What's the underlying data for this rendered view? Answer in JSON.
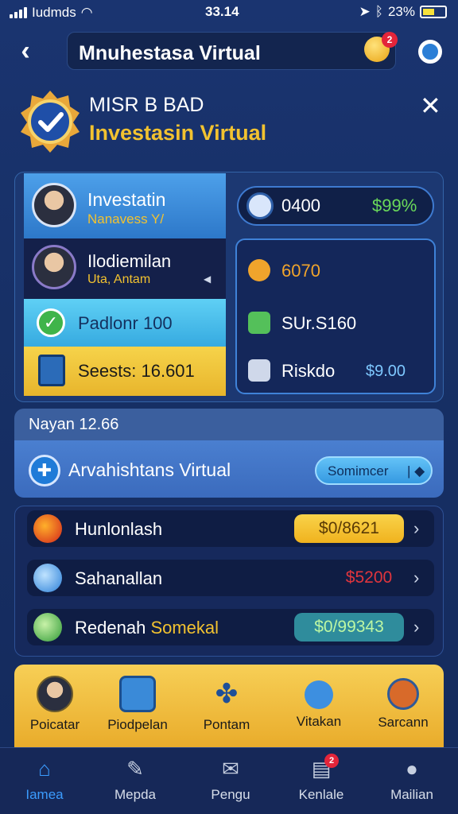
{
  "status_bar": {
    "carrier": "Iudmds",
    "time": "33.14",
    "battery": "23%"
  },
  "header": {
    "title": "Mnuhestasa Virtual",
    "notification_count": "2"
  },
  "hero": {
    "line1": "MISR B BAD",
    "line2": "Investasin Virtual"
  },
  "profile_card": {
    "row1": {
      "name": "Investatin",
      "sub": "Nanavess Y/"
    },
    "row2": {
      "name": "Ilodiemilan",
      "sub": "Uta, Antam"
    },
    "row3": {
      "label": "Padlonr 100"
    },
    "row4": {
      "label": "Seests: 16.601"
    }
  },
  "balance_pill": {
    "value": "0400",
    "percent": "$99%"
  },
  "stats_panel": {
    "item1": "6070",
    "item2": "SUr.S160",
    "item3": "Riskdo",
    "item3_value": "$9.00"
  },
  "strip": {
    "heading": "Nayan 12.66",
    "label": "Arvahishtans Virtual",
    "button": "Somimcer"
  },
  "list": [
    {
      "label": "Hunlonlash",
      "value": "$0/8621",
      "value_color": "#f0b21e"
    },
    {
      "label": "Sahanallan",
      "value": "$5200",
      "value_color": "#e0353d"
    },
    {
      "label": "Redenah",
      "label_highlight": "Somekal",
      "value": "$0/99343",
      "value_color": "#2f8c9c"
    }
  ],
  "quick_menu": [
    "Poicatar",
    "Piodpelan",
    "Pontam",
    "Vitakan",
    "Sarcann"
  ],
  "tab_bar": {
    "items": [
      "Iamea",
      "Mepda",
      "Pengu",
      "Kenlale",
      "Mailian"
    ],
    "active_index": 0,
    "badge": "2"
  },
  "colors": {
    "accent_gold": "#f2c230",
    "positive_green": "#6ad95a",
    "negative_red": "#e0353d",
    "active_blue": "#3b9cff"
  }
}
